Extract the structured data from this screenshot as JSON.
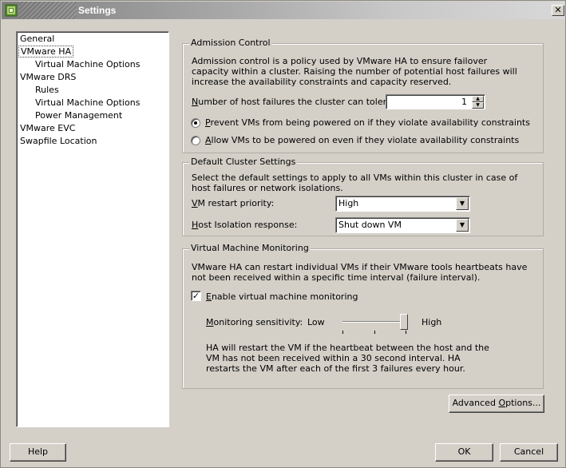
{
  "window": {
    "title": "Settings",
    "close_glyph": "✕"
  },
  "tree": {
    "items": [
      {
        "label": "General",
        "indent": 0
      },
      {
        "label": "VMware HA",
        "indent": 0,
        "selected": true
      },
      {
        "label": "Virtual Machine Options",
        "indent": 1
      },
      {
        "label": "VMware DRS",
        "indent": 0
      },
      {
        "label": "Rules",
        "indent": 1
      },
      {
        "label": "Virtual Machine Options",
        "indent": 1
      },
      {
        "label": "Power Management",
        "indent": 1
      },
      {
        "label": "VMware EVC",
        "indent": 0
      },
      {
        "label": "Swapfile Location",
        "indent": 0
      }
    ]
  },
  "admission": {
    "legend": "Admission Control",
    "description": "Admission control is a policy used by VMware HA to ensure failover capacity within a cluster. Raising the number of potential host failures will increase the availability constraints and capacity reserved.",
    "host_failures_label_u": "N",
    "host_failures_label_rest": "umber of host failures the cluster can tolerate:",
    "host_failures_value": "1",
    "prevent_u": "P",
    "prevent_rest": "revent VMs from being powered on if they violate availability constraints",
    "allow_u": "A",
    "allow_rest": "llow VMs to be powered on even if they violate availability constraints",
    "prevent_selected": true
  },
  "defaults": {
    "legend": "Default Cluster Settings",
    "description": "Select the default settings to apply to all VMs within this cluster in case of host failures or network isolations.",
    "restart_label_u": "V",
    "restart_label_rest": "M restart priority:",
    "restart_value": "High",
    "isolation_label_u": "H",
    "isolation_label_rest": "ost Isolation response:",
    "isolation_value": "Shut down VM"
  },
  "monitoring": {
    "legend": "Virtual Machine Monitoring",
    "description": "VMware HA can restart individual VMs if their VMware tools heartbeats have not been received within a specific time interval (failure interval).",
    "enable_u": "E",
    "enable_rest": "nable virtual machine monitoring",
    "enable_checked": true,
    "sensitivity_u": "M",
    "sensitivity_rest": "onitoring sensitivity:",
    "low": "Low",
    "high": "High",
    "sensitivity_level": 1.0,
    "note": "HA will restart the VM if the heartbeat between the host and the VM has not been received within a 30 second interval. HA restarts the VM after each of the first 3 failures every hour."
  },
  "buttons": {
    "advanced_pre": "Advanced ",
    "advanced_u": "O",
    "advanced_post": "ptions...",
    "help": "Help",
    "ok": "OK",
    "cancel": "Cancel"
  }
}
